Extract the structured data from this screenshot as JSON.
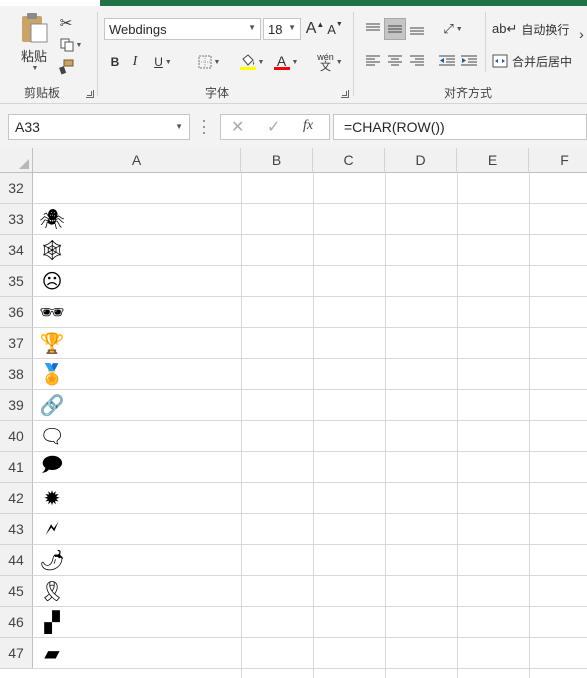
{
  "ribbon": {
    "clipboard": {
      "paste_label": "粘贴",
      "group_label": "剪贴板"
    },
    "font": {
      "font_name": "Webdings",
      "font_size": "18",
      "grow_label": "A",
      "shrink_label": "A",
      "bold_label": "B",
      "italic_label": "I",
      "underline_label": "U",
      "color_letter": "A",
      "wen_label": "wén",
      "wen_char": "文",
      "group_label": "字体"
    },
    "alignment": {
      "wrap_label": "自动换行",
      "merge_label": "合并后居中",
      "group_label": "对齐方式"
    }
  },
  "formula_bar": {
    "name_box": "A33",
    "formula": "=CHAR(ROW())"
  },
  "grid": {
    "columns": [
      "A",
      "B",
      "C",
      "D",
      "E",
      "F"
    ],
    "rows": [
      {
        "num": "32",
        "symbol": ""
      },
      {
        "num": "33",
        "symbol": "🕷"
      },
      {
        "num": "34",
        "symbol": "🕸"
      },
      {
        "num": "35",
        "symbol": "☹"
      },
      {
        "num": "36",
        "symbol": "🕶"
      },
      {
        "num": "37",
        "symbol": "🏆"
      },
      {
        "num": "38",
        "symbol": "🏅"
      },
      {
        "num": "39",
        "symbol": "🔗"
      },
      {
        "num": "40",
        "symbol": "🗨"
      },
      {
        "num": "41",
        "symbol": "🗩"
      },
      {
        "num": "42",
        "symbol": "✹"
      },
      {
        "num": "43",
        "symbol": "🗲"
      },
      {
        "num": "44",
        "symbol": "🌶"
      },
      {
        "num": "45",
        "symbol": "🎗"
      },
      {
        "num": "46",
        "symbol": "▞"
      },
      {
        "num": "47",
        "symbol": "▰"
      }
    ]
  }
}
